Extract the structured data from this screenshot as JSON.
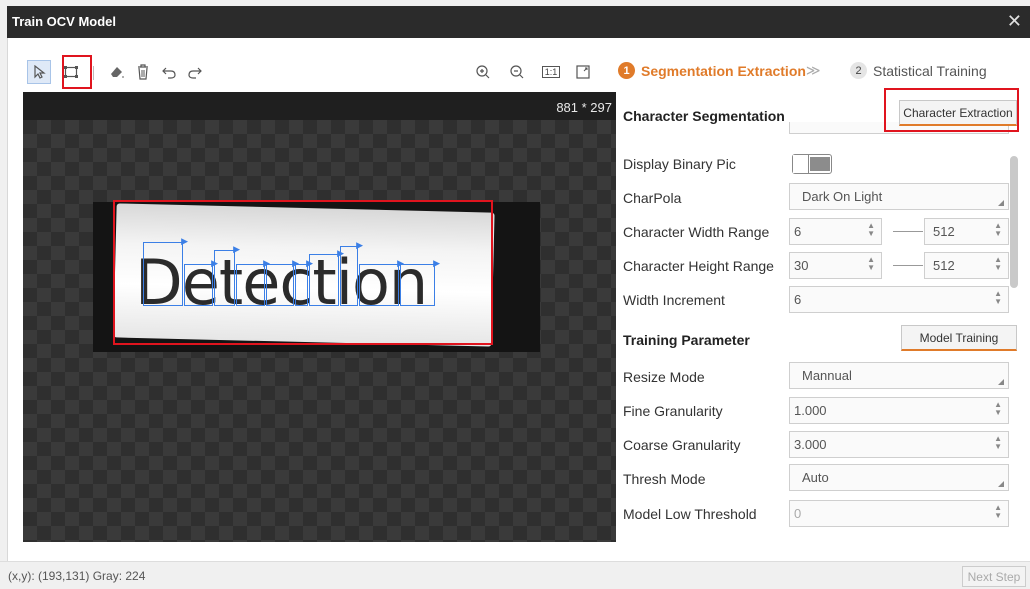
{
  "window": {
    "title": "Train OCV Model",
    "close_glyph": "✕"
  },
  "toolbar": {
    "select_icon": "pointer-icon",
    "rect_icon": "rectangle-roi-icon",
    "eraser_icon": "eraser-icon",
    "delete_icon": "trash-icon",
    "undo_icon": "undo-icon",
    "redo_icon": "redo-icon",
    "zoom_in_icon": "zoom-in-icon",
    "zoom_out_icon": "zoom-out-icon",
    "actual_size_label": "1:1",
    "fit_icon": "fit-window-icon"
  },
  "canvas": {
    "dimensions": "881 * 297",
    "image_text": "Detection"
  },
  "steps": {
    "step1": {
      "number": "1",
      "label": "Segmentation Extraction",
      "arrows": "≫"
    },
    "step2": {
      "number": "2",
      "label": "Statistical Training"
    }
  },
  "segmentation": {
    "title": "Character Segmentation",
    "button": "Character Extraction",
    "display_binary_label": "Display Binary Pic",
    "charpola_label": "CharPola",
    "charpola_value": "Dark On Light",
    "width_range_label": "Character Width Range",
    "width_min": "6",
    "width_max": "512",
    "height_range_label": "Character Height Range",
    "height_min": "30",
    "height_max": "512",
    "width_increment_label": "Width Increment",
    "width_increment_value": "6"
  },
  "training": {
    "title": "Training Parameter",
    "button": "Model Training",
    "resize_label": "Resize Mode",
    "resize_value": "Mannual",
    "fine_label": "Fine Granularity",
    "fine_value": "1.000",
    "coarse_label": "Coarse Granularity",
    "coarse_value": "3.000",
    "thresh_label": "Thresh Mode",
    "thresh_value": "Auto",
    "low_thresh_label": "Model Low Threshold",
    "low_thresh_value": "0"
  },
  "status": {
    "coords": "(x,y): (193,131) Gray: 224",
    "next_button": "Next Step"
  },
  "colors": {
    "accent": "#e07b2a",
    "highlight_red": "#e0141e",
    "box_blue": "#3b7fe6",
    "titlebar": "#2b2b2b"
  }
}
